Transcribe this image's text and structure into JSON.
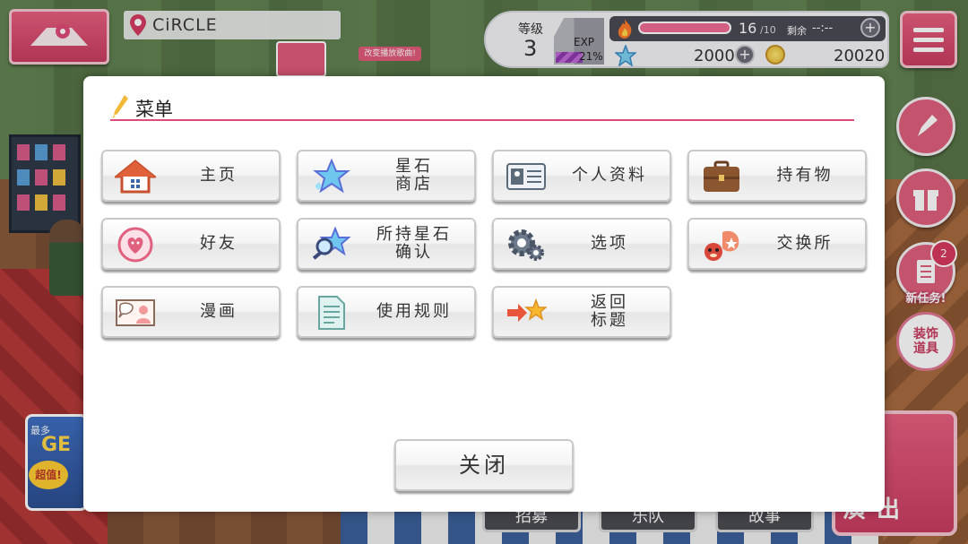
{
  "hud": {
    "location": "CiRCLE",
    "level_label": "等级",
    "level": "3",
    "exp_label": "EXP",
    "exp_percent": "21%",
    "exp_fraction": 0.21,
    "stamina": "16",
    "stamina_max": "/10",
    "remaining_label": "剩余",
    "remaining_time": "--:--",
    "stars": "2000",
    "coins": "20020",
    "plus_symbol": "+"
  },
  "side": {
    "mission_badge": "2",
    "mission_label": "新任务!",
    "deco_label": "装饰\n道具"
  },
  "bottom": {
    "tabs": [
      "招募",
      "乐队",
      "故事"
    ],
    "live_label": "演出",
    "get_small": "最多",
    "get_text": "GE",
    "get_deal": "超值!"
  },
  "background": {
    "song_tag": "改变播放歌曲!"
  },
  "modal": {
    "title": "菜单",
    "items": [
      {
        "label": "主页",
        "icon": "home-icon"
      },
      {
        "label": "星石\n商店",
        "icon": "star-shop-icon"
      },
      {
        "label": "个人资料",
        "icon": "profile-card-icon"
      },
      {
        "label": "持有物",
        "icon": "briefcase-icon"
      },
      {
        "label": "好友",
        "icon": "friends-heart-icon"
      },
      {
        "label": "所持星石\n确认",
        "icon": "star-search-icon"
      },
      {
        "label": "选项",
        "icon": "gear-icon"
      },
      {
        "label": "交换所",
        "icon": "exchange-icon"
      },
      {
        "label": "漫画",
        "icon": "comic-icon"
      },
      {
        "label": "使用规则",
        "icon": "document-icon"
      },
      {
        "label": "返回\n标题",
        "icon": "return-arrow-icon"
      }
    ],
    "close_label": "关闭"
  },
  "colors": {
    "accent": "#e04c78",
    "button_pink": "#c93c60"
  }
}
